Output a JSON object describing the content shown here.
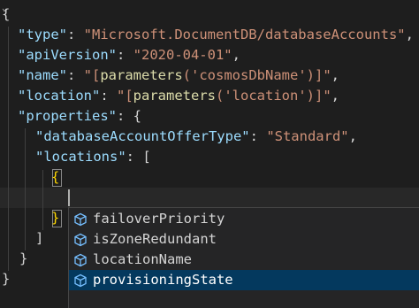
{
  "editor": {
    "lines": [
      [
        {
          "t": "{",
          "c": "tok-brace"
        }
      ],
      [
        {
          "t": "\"type\"",
          "c": "tok-key"
        },
        {
          "t": ": ",
          "c": "tok-punc"
        },
        {
          "t": "\"Microsoft.DocumentDB/databaseAccounts\"",
          "c": "tok-str"
        },
        {
          "t": ",",
          "c": "tok-punc"
        }
      ],
      [
        {
          "t": "\"apiVersion\"",
          "c": "tok-key"
        },
        {
          "t": ": ",
          "c": "tok-punc"
        },
        {
          "t": "\"2020-04-01\"",
          "c": "tok-str"
        },
        {
          "t": ",",
          "c": "tok-punc"
        }
      ],
      [
        {
          "t": "\"name\"",
          "c": "tok-key"
        },
        {
          "t": ": ",
          "c": "tok-punc"
        },
        {
          "t": "\"[",
          "c": "tok-str"
        },
        {
          "t": "parameters",
          "c": "tok-fn"
        },
        {
          "t": "('cosmosDbName')",
          "c": "tok-str"
        },
        {
          "t": "]\"",
          "c": "tok-str"
        },
        {
          "t": ",",
          "c": "tok-punc"
        }
      ],
      [
        {
          "t": "\"location\"",
          "c": "tok-key"
        },
        {
          "t": ": ",
          "c": "tok-punc"
        },
        {
          "t": "\"[",
          "c": "tok-str"
        },
        {
          "t": "parameters",
          "c": "tok-fn"
        },
        {
          "t": "('location')",
          "c": "tok-str"
        },
        {
          "t": "]\"",
          "c": "tok-str"
        },
        {
          "t": ",",
          "c": "tok-punc"
        }
      ],
      [
        {
          "t": "\"properties\"",
          "c": "tok-key"
        },
        {
          "t": ": {",
          "c": "tok-punc"
        }
      ],
      [
        {
          "t": "\"databaseAccountOfferType\"",
          "c": "tok-key"
        },
        {
          "t": ": ",
          "c": "tok-punc"
        },
        {
          "t": "\"Standard\"",
          "c": "tok-str"
        },
        {
          "t": ",",
          "c": "tok-punc"
        }
      ],
      [
        {
          "t": "\"locations\"",
          "c": "tok-key"
        },
        {
          "t": ": [",
          "c": "tok-punc"
        }
      ],
      [
        {
          "t": "{",
          "c": "tok-bracket-yellow"
        }
      ],
      [],
      [
        {
          "t": "}",
          "c": "tok-bracket-yellow"
        }
      ],
      [
        {
          "t": "]",
          "c": "tok-punc"
        }
      ],
      [
        {
          "t": "}",
          "c": "tok-punc"
        }
      ],
      [
        {
          "t": "}",
          "c": "tok-brace"
        }
      ]
    ]
  },
  "suggest": {
    "items": [
      {
        "label": "failoverPriority",
        "icon": "property-icon"
      },
      {
        "label": "isZoneRedundant",
        "icon": "property-icon"
      },
      {
        "label": "locationName",
        "icon": "property-icon"
      },
      {
        "label": "provisioningState",
        "icon": "property-icon",
        "selected": true
      }
    ]
  }
}
